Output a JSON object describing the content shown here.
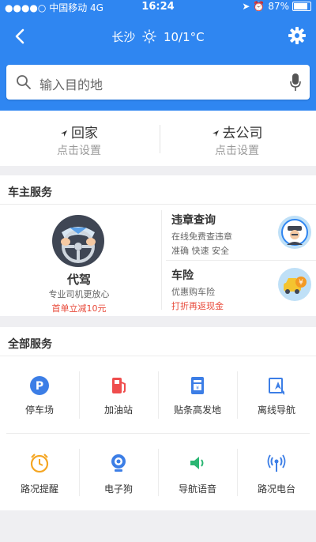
{
  "status_bar": {
    "carrier": "中国移动",
    "network": "4G",
    "time": "16:24",
    "battery": "87%"
  },
  "header": {
    "city": "长沙",
    "temperature": "10/1°C"
  },
  "search": {
    "placeholder": "输入目的地"
  },
  "quick_actions": [
    {
      "title": "回家",
      "subtitle": "点击设置"
    },
    {
      "title": "去公司",
      "subtitle": "点击设置"
    }
  ],
  "owner_services": {
    "title": "车主服务",
    "designated_driver": {
      "title": "代驾",
      "subtitle": "专业司机更放心",
      "promo": "首单立减10元"
    },
    "violation": {
      "title": "违章查询",
      "line1": "在线免费查违章",
      "line2": "准确 快速 安全"
    },
    "insurance": {
      "title": "车险",
      "line1": "优惠购车险",
      "promo": "打折再返现金"
    }
  },
  "all_services": {
    "title": "全部服务",
    "items": [
      {
        "label": "停车场",
        "icon": "parking-icon"
      },
      {
        "label": "加油站",
        "icon": "gas-station-icon"
      },
      {
        "label": "贴条高发地",
        "icon": "ticket-hotspot-icon"
      },
      {
        "label": "离线导航",
        "icon": "offline-nav-icon"
      },
      {
        "label": "路况提醒",
        "icon": "alarm-clock-icon"
      },
      {
        "label": "电子狗",
        "icon": "camera-icon"
      },
      {
        "label": "导航语音",
        "icon": "speaker-icon"
      },
      {
        "label": "路况电台",
        "icon": "radio-antenna-icon"
      }
    ]
  },
  "colors": {
    "primary": "#2f86f1",
    "promo": "#e84a3a",
    "background": "#efeff2"
  }
}
